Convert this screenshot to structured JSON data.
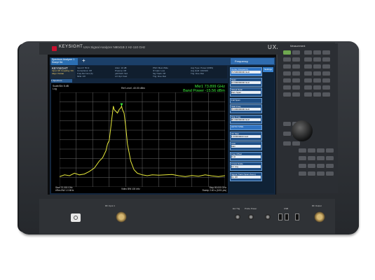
{
  "brand": "KEYSIGHT",
  "model_label": "UXA Signal Analyzer N9041B 2 Hz-110 GHz",
  "model_badge": "UXA",
  "screen": {
    "tab_label": "Spectrum Analyzer 1 Swept SA",
    "add_tab": "+",
    "softkey_header": "Frequency",
    "settings": "Settings",
    "keysight_block": "KEYSIGHT",
    "keysight_sub": "Input: RF Coupling: DC Align: Partial",
    "info_cols": [
      [
        "Input Z: 50 Ω",
        "Corrections: Off",
        "Freq Ref: Ext (S)",
        "NFE: Off"
      ],
      [
        "Atten: 10 dB",
        "Preamp: Off",
        "µW Path: Std",
        "LO Opt: Fast"
      ],
      [
        "PNO: Best Wide",
        "IF Gain: Low",
        "Sig Track: Off",
        "Trig: Free Run"
      ],
      [
        "Avg Type: Power (RMS)",
        "Avg Hold: 100/100",
        "Trig: Free Run",
        ""
      ]
    ],
    "trace_tab": "1 Spectrum",
    "scale": "Scale/Div 5 dB",
    "log": "Log",
    "ref_level": "Ref Level -40.00 dBm",
    "marker_line1": "Mkr1  73.899 GHz",
    "marker_line2": "Band Power  -15.56 dBm",
    "start": "Start 70.000 GHz",
    "res_bw": "#Res BW 1.0 MHz",
    "video_bw": "Video BW 100 kHz",
    "stop": "Stop 80.000 GHz",
    "sweep": "Sweep 2.40 s (1001 pts)",
    "softkeys": [
      {
        "title": "Center Frequency",
        "value": "73.500000000 GHz",
        "hl": true
      },
      {
        "title": "Span",
        "value": "10.000000000 GHz",
        "hl": false
      },
      {
        "title": "Swept Span",
        "value": "Zero Span",
        "hl": false
      },
      {
        "title": "Full Span",
        "value": "",
        "hl": false
      },
      {
        "title": "Start Freq",
        "value": "70.000000000 GHz",
        "hl": false
      },
      {
        "title": "Stop Freq",
        "value": "80.000000000 GHz",
        "hl": false
      },
      {
        "title": "AUTO TUNE",
        "value": "",
        "hl": true
      },
      {
        "title": "CF Step",
        "value": "1.000000000 GHz",
        "hl": false
      },
      {
        "title": "Auto",
        "value": "Man",
        "hl": false
      },
      {
        "title": "Freq Offset",
        "value": "0 Hz",
        "hl": false
      },
      {
        "title": "X Axis Scale",
        "value": "Lin  Log",
        "hl": false
      },
      {
        "title": "Signal Track (Span Zoom)",
        "value": "On  Off",
        "hl": false
      }
    ]
  },
  "front_panel": {
    "panel_header": "Measurement",
    "rf_input_label": "RF Input 1",
    "rf_output_label": "RF Output",
    "ext_trig_label": "Ext Trig",
    "probe_label": "Probe Power",
    "usb_label": "USB"
  },
  "chart_data": {
    "type": "line",
    "x_range_ghz": [
      70,
      80
    ],
    "ylim": [
      -95,
      -40
    ],
    "ylabel": "dBm",
    "grid": true,
    "series": [
      {
        "color": "#e6e83a",
        "x": [
          70.0,
          70.3,
          70.6,
          70.9,
          71.2,
          71.5,
          71.8,
          72.1,
          72.4,
          72.6,
          72.8,
          72.9,
          73.0,
          73.1,
          73.2,
          73.25,
          73.3,
          73.4,
          73.5,
          73.6,
          73.7,
          73.75,
          73.8,
          73.9,
          74.0,
          74.1,
          74.3,
          74.5,
          74.7,
          75.0,
          75.3,
          75.6,
          76.0,
          76.4,
          76.8,
          77.2,
          77.6,
          78.0,
          78.4,
          78.8,
          79.2,
          79.6,
          80.0
        ],
        "y": [
          -89,
          -88,
          -88.5,
          -87,
          -88,
          -87.5,
          -86,
          -84,
          -80,
          -78,
          -74,
          -70,
          -68,
          -60,
          -52,
          -48,
          -50,
          -51,
          -52,
          -50,
          -49,
          -48,
          -50,
          -52,
          -60,
          -70,
          -80,
          -85,
          -87,
          -88,
          -88.5,
          -88,
          -88.2,
          -88,
          -87.8,
          -88.5,
          -89,
          -88.4,
          -88.8,
          -88,
          -88.6,
          -89,
          -88.5
        ]
      }
    ]
  }
}
